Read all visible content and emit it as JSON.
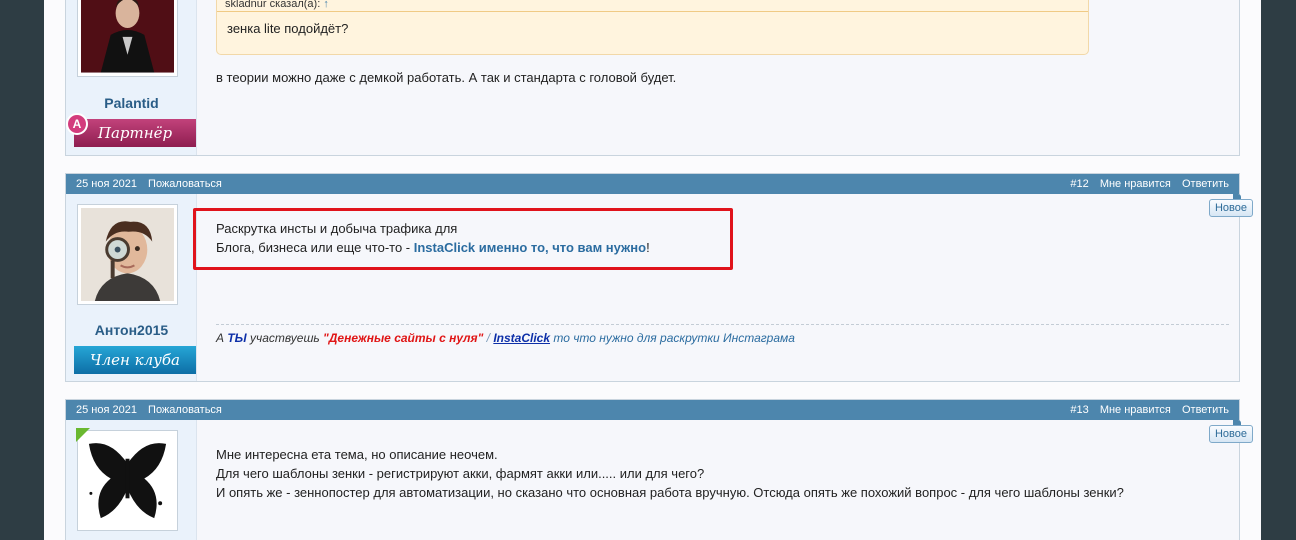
{
  "post1": {
    "username": "Palantid",
    "badge": "Партнёр",
    "badge_icon": "A",
    "quote_author": "skladnur сказал(а):",
    "quote_arrow": "↑",
    "quote_text": "зенка lite подойдёт?",
    "text": "в теории можно даже с демкой работать. А так и стандарта с головой будет."
  },
  "post2": {
    "date": "25 ноя 2021",
    "report": "Пожаловаться",
    "number": "#12",
    "like": "Мне нравится",
    "reply": "Ответить",
    "new_label": "Новое",
    "username": "Антон2015",
    "badge": "Член клуба",
    "line1": "Раскрутка инсты и добыча трафика для",
    "line2_prefix": "Блога, бизнеса или еще что-то - ",
    "line2_link": "InstaClick именно то, что вам нужно",
    "line2_suffix": "!",
    "sig": {
      "a": "А ",
      "ty": "ТЫ",
      "participates": " участвуешь ",
      "quote_open": "\"",
      "money": "Денежные сайты с нуля",
      "quote_close": "\"",
      "sep": " / ",
      "insta": "InstaClick",
      "rest": " то что нужно для раскрутки ",
      "instagram": "Инстаграма"
    }
  },
  "post3": {
    "date": "25 ноя 2021",
    "report": "Пожаловаться",
    "number": "#13",
    "like": "Мне нравится",
    "reply": "Ответить",
    "new_label": "Новое",
    "line1": "Мне интересна ета тема, но описание неочем.",
    "line2": "Для чего шаблоны зенки - регистрируют акки, фармят акки или..... или для чего?",
    "line3": "И опять же - зеннопостер для автоматизации, но сказано что основная работа вручную. Отсюда опять же похожий вопрос - для чего шаблоны зенки?"
  },
  "colors": {
    "header": "#4d86ad",
    "highlight_box": "#e0131b",
    "link": "#2b6ca0"
  }
}
